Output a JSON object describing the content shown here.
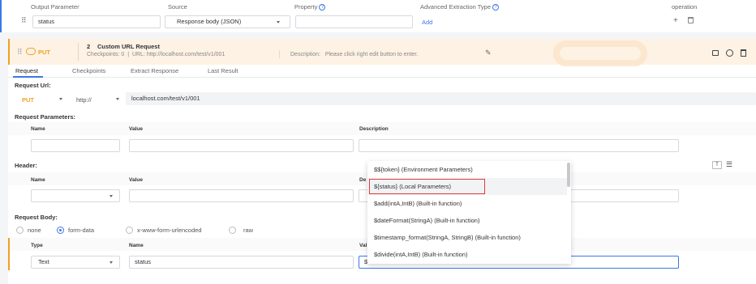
{
  "top_table": {
    "headers": {
      "output_param": "Output Parameter",
      "source": "Source",
      "property": "Property",
      "advanced": "Advanced Extraction Type",
      "operation": "operation"
    },
    "row": {
      "output_param": "status",
      "source": "Response body (JSON)",
      "property": "",
      "advanced_link": "Add"
    },
    "add_icon": "+",
    "delete_icon": "trash"
  },
  "step": {
    "method": "PUT",
    "number": "2",
    "name": "Custom URL Request",
    "checkpoints_label": "Checkpoints:",
    "checkpoints_count": "0",
    "url_label": "URL:",
    "url": "http://localhost.com/test/v1/001",
    "description_label": "Description:",
    "description": "Please click right edit button to enter."
  },
  "tabs": [
    "Request",
    "Checkpoints",
    "Extract Response",
    "Last Result"
  ],
  "request_url": {
    "label": "Request Url:",
    "method": "PUT",
    "protocol": "http://",
    "host": "localhost.com/test/v1/001"
  },
  "request_params": {
    "label": "Request Parameters:",
    "headers": {
      "name": "Name",
      "value": "Value",
      "description": "Description"
    }
  },
  "header_section": {
    "label": "Header:",
    "headers": {
      "name": "Name",
      "value": "Value",
      "description": "De"
    }
  },
  "request_body": {
    "label": "Request Body:",
    "options": [
      "none",
      "form-data",
      "x-www-form-urlencoded",
      "raw"
    ],
    "selected": "form-data",
    "headers": {
      "type": "Type",
      "name": "Name",
      "value": "Val"
    },
    "row": {
      "type": "Text",
      "name": "status",
      "value": "$"
    }
  },
  "autocomplete": {
    "items": [
      "$${token} (Environment Parameters)",
      "${status} (Local Parameters)",
      "$add(intA,IntB) (Built-in function)",
      "$dateFormat(StringA) (Built-in function)",
      "$timestamp_format(StringA, StringB) (Built-in function)",
      "$divide(intA,IntB) (Built-in function)"
    ],
    "highlighted_index": 1
  },
  "colors": {
    "accent": "#3b78e7",
    "method": "#f0a020",
    "highlight_border": "#e23b3b",
    "step_bg": "#fdf2e4"
  }
}
